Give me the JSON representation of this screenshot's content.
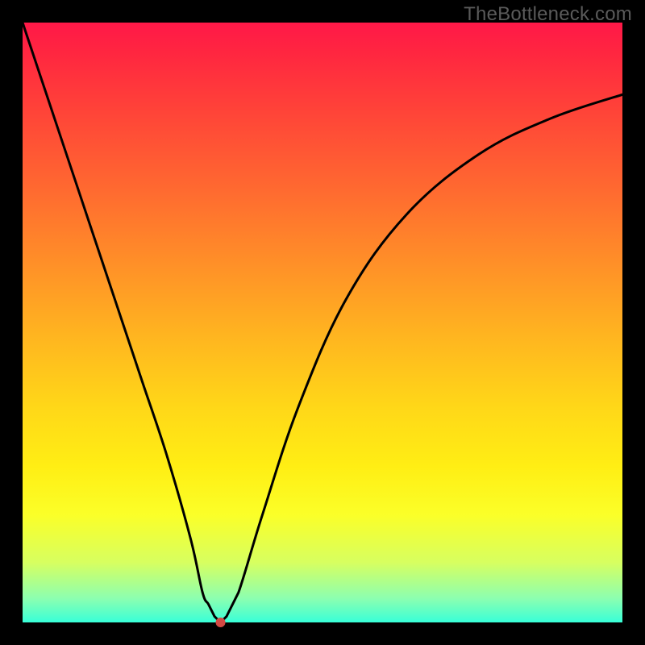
{
  "watermark": "TheBottleneck.com",
  "chart_data": {
    "type": "line",
    "title": "",
    "xlabel": "",
    "ylabel": "",
    "xlim": [
      0,
      100
    ],
    "ylim": [
      0,
      100
    ],
    "series": [
      {
        "name": "bottleneck-curve",
        "x": [
          0,
          4,
          8,
          12,
          16,
          20,
          24,
          28,
          30,
          31,
          32,
          33,
          34,
          36,
          40,
          46,
          54,
          64,
          76,
          88,
          100
        ],
        "values": [
          100,
          88,
          76,
          64,
          52,
          40,
          28,
          14,
          5,
          3,
          1,
          0,
          1,
          5,
          18,
          36,
          54,
          68,
          78,
          84,
          88
        ]
      }
    ],
    "marker": {
      "x": 33,
      "y": 0,
      "color": "#d24a44",
      "radius": 6
    },
    "background_gradient_stops": [
      {
        "pos": 0,
        "color": "#ff1848"
      },
      {
        "pos": 50,
        "color": "#ffb420"
      },
      {
        "pos": 82,
        "color": "#fbff28"
      },
      {
        "pos": 100,
        "color": "#38ffd8"
      }
    ]
  }
}
